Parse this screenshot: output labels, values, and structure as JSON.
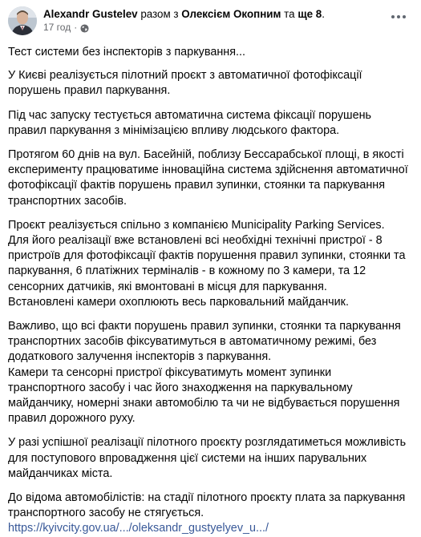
{
  "post": {
    "author": "Alexandr Gustelev",
    "connector1": " разом з ",
    "tagged": "Олексієм Окопним",
    "connector2": " та ",
    "others": "ще 8",
    "period": ".",
    "timestamp": "17 год",
    "dot": "·",
    "paragraphs": [
      "Тест системи без інспекторів з паркування...",
      "У Києві реалізується пілотний проєкт з автоматичної фотофіксації порушень правил паркування.",
      "Під час запуску тестується автоматична система фіксації порушень правил паркування з мінімізацією впливу людського фактора.",
      "Протягом 60 днів на вул. Басейній, поблизу Бессарабської площі, в якості експерименту працюватиме інноваційна система здійснення автоматичної фотофіксації фактів порушень правил зупинки, стоянки та паркування транспортних засобів.",
      "Проєкт реалізується спільно з компанією Municipality Parking Services.\nДля його реалізації вже встановлені всі необхідні технічні пристрої - 8 пристроїв для фотофіксації фактів порушення правил зупинки, стоянки та паркування, 6 платіжних терміналів - в кожному по 3 камери, та 12 сенсорних датчиків, які вмонтовані в місця для паркування.\nВстановлені камери охоплюють весь парковальний майданчик.",
      "Важливо, що всі факти порушень правил зупинки, стоянки та паркування транспортних засобів фіксуватимуться в автоматичному режимі, без додаткового залучення інспекторів з паркування.\nКамери та  сенсорні пристрої  фіксуватимуть момент зупинки транспортного засобу і час його знаходження на паркувальному майданчику, номерні знаки автомобілю та чи не відбувається порушення правил дорожного руху.",
      "У разі успішної реалізації пілотного проєкту розглядатиметься можливість для поступового впровадження цієї системи на інших парувальних майданчиках міста.",
      "До відома автомобілістів: на стадії пілотного проєкту плата за паркування транспортного засобу не стягується."
    ],
    "link": "https://kyivcity.gov.ua/.../oleksandr_gustyelyev_u.../"
  },
  "colors": {
    "link": "#385898",
    "muted": "#65676b",
    "text": "#050505"
  },
  "icons": {
    "visibility": "globe-icon",
    "menu": "more-options-icon"
  }
}
